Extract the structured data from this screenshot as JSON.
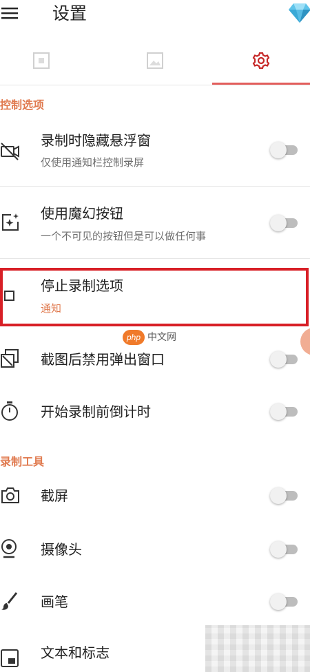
{
  "header": {
    "title": "设置",
    "menu_icon": "hamburger-menu-icon",
    "premium_icon": "diamond-icon"
  },
  "tabs": [
    {
      "icon": "video-frame-icon",
      "selected": false
    },
    {
      "icon": "image-icon",
      "selected": false
    },
    {
      "icon": "gear-icon",
      "selected": true
    }
  ],
  "colors": {
    "accent": "#e07a4f",
    "tab_indicator": "#e35d5b",
    "highlight_border": "#d81f26"
  },
  "sections": {
    "control": {
      "title": "控制选项",
      "items": [
        {
          "title": "录制时隐藏悬浮窗",
          "subtitle": "仅使用通知栏控制录屏",
          "icon": "camera-off-icon",
          "toggle": false
        },
        {
          "title": "使用魔幻按钮",
          "subtitle": "一个不可见的按钮但是可以做任何事",
          "icon": "magic-sparkle-icon",
          "toggle": false
        },
        {
          "title": "停止录制选项",
          "subtitle": "通知",
          "icon": "stop-square-icon"
        },
        {
          "title": "截图后禁用弹出窗口",
          "icon": "screenshot-popup-icon",
          "toggle": false
        },
        {
          "title": "开始录制前倒计时",
          "icon": "timer-icon",
          "toggle": false
        }
      ]
    },
    "tools": {
      "title": "录制工具",
      "items": [
        {
          "title": "截屏",
          "icon": "camera-icon",
          "toggle": false
        },
        {
          "title": "摄像头",
          "icon": "webcam-icon",
          "toggle": false
        },
        {
          "title": "画笔",
          "icon": "brush-icon",
          "toggle": false
        },
        {
          "title": "文本和标志",
          "icon": "text-logo-icon"
        }
      ]
    }
  },
  "watermark": {
    "logo": "php",
    "text": "中文网"
  }
}
